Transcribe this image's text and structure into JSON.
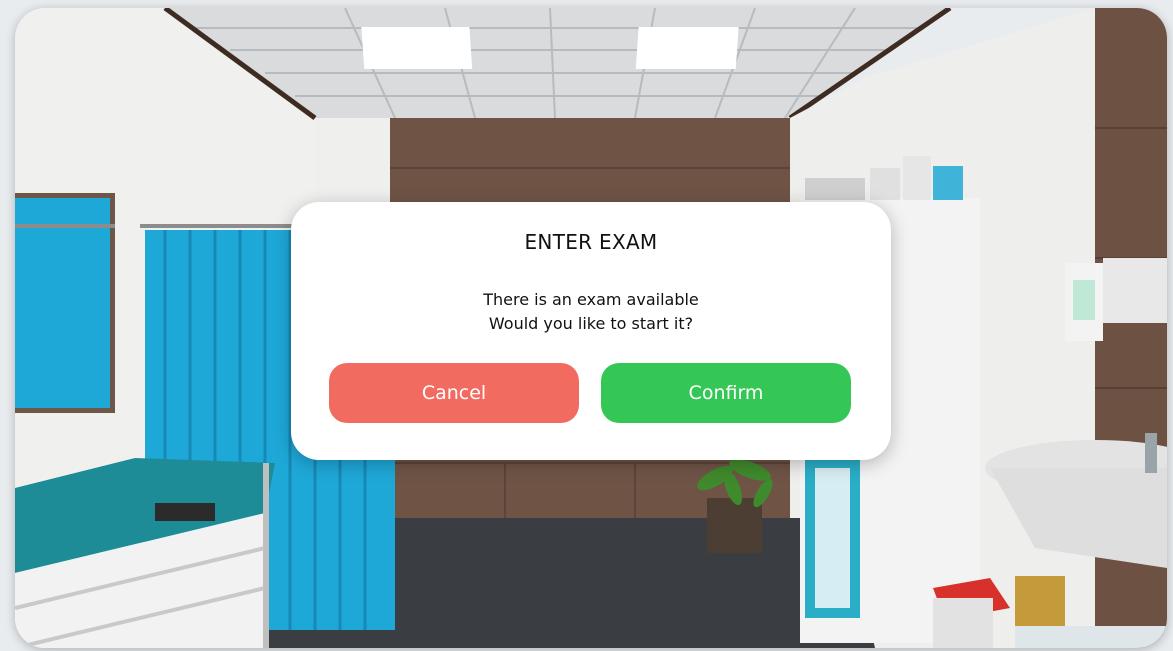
{
  "dialog": {
    "title": "ENTER EXAM",
    "message_line1": "There is an exam available",
    "message_line2": "Would you like to start it?",
    "cancel_label": "Cancel",
    "confirm_label": "Confirm"
  },
  "colors": {
    "cancel": "#f26b61",
    "confirm": "#35c755",
    "dialog_bg": "#ffffff",
    "curtain": "#1ea8d8",
    "exam_table": "#1e8c97"
  }
}
